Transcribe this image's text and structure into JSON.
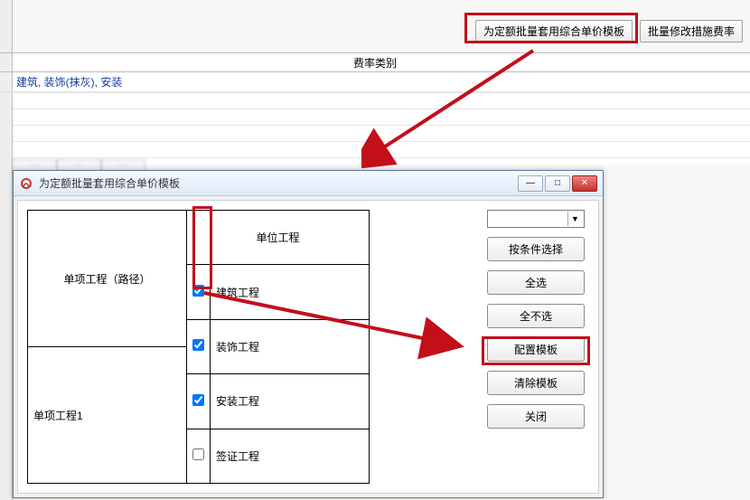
{
  "toolbar": {
    "apply_template_label": "为定额批量套用综合单价模板",
    "modify_rate_label": "批量修改措施费率"
  },
  "category_header": "费率类别",
  "row1_text": "建筑, 装饰(抹灰), 安装",
  "dialog": {
    "title": "为定额批量套用综合单价模板",
    "headers": {
      "project_path": "单项工程（路径）",
      "unit_project": "单位工程"
    },
    "project_row": "单项工程1",
    "units": [
      {
        "label": "建筑工程",
        "checked": true
      },
      {
        "label": "装饰工程",
        "checked": true
      },
      {
        "label": "安装工程",
        "checked": true
      },
      {
        "label": "签证工程",
        "checked": false
      }
    ],
    "buttons": {
      "combo_selected": "",
      "by_condition": "按条件选择",
      "select_all": "全选",
      "deselect_all": "全不选",
      "configure": "配置模板",
      "clear": "清除模板",
      "close": "关闭"
    }
  },
  "win": {
    "min": "—",
    "max": "□",
    "close": "✕"
  }
}
